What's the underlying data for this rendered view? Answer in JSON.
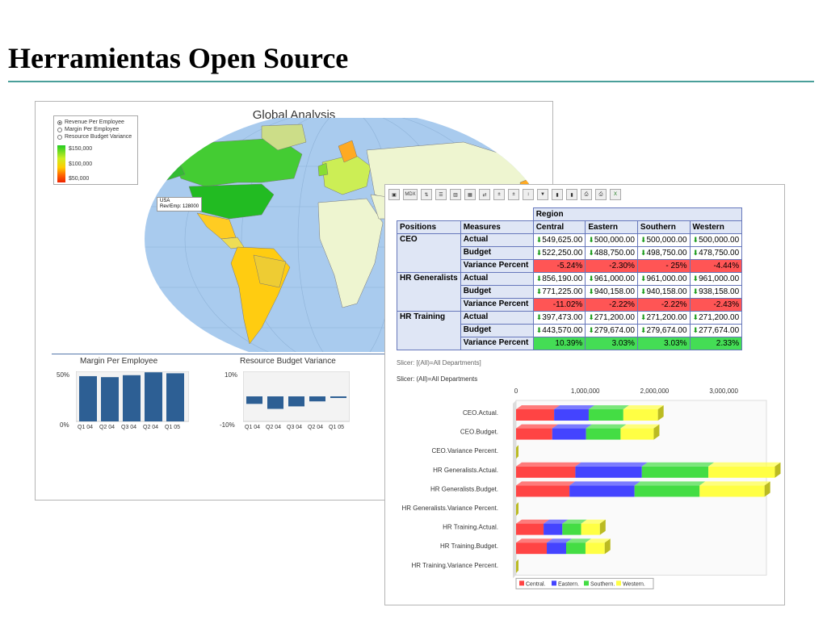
{
  "slide": {
    "title": "Herramientas Open Source"
  },
  "global_analysis": {
    "title": "Global Analysis",
    "options": [
      "Revenue Per Employee",
      "Margin Per Employee",
      "Resource Budget Variance"
    ],
    "scale_labels": [
      "$150,000",
      "$100,000",
      "$50,000"
    ],
    "tooltip": {
      "line1": "USA",
      "line2": "Rev/Emp: 128000"
    },
    "margin_chart": {
      "title": "Margin Per Employee",
      "y_ticks": [
        "50%",
        "0%"
      ],
      "categories": [
        "Q1 04",
        "Q2 04",
        "Q3 04",
        "Q2 04",
        "Q1 05"
      ],
      "values": [
        47,
        46,
        48,
        51,
        50
      ]
    },
    "budget_chart": {
      "title": "Resource Budget Variance",
      "y_ticks": [
        "10%",
        "-10%"
      ],
      "categories": [
        "Q1 04",
        "Q2 04",
        "Q3 04",
        "Q2 04",
        "Q1 05"
      ],
      "values": [
        -3,
        -5,
        -4,
        -2,
        -0.5
      ]
    }
  },
  "olap": {
    "toolbar_mdx": "MDX",
    "region_header": "Region",
    "col_positions": "Positions",
    "col_measures": "Measures",
    "regions": [
      "Central",
      "Eastern",
      "Southern",
      "Western"
    ],
    "groups": [
      {
        "position": "CEO",
        "rows": [
          {
            "measure": "Actual",
            "values": [
              "549,625.00",
              "500,000.00",
              "500,000.00",
              "500,000.00"
            ]
          },
          {
            "measure": "Budget",
            "values": [
              "522,250.00",
              "488,750.00",
              "498,750.00",
              "478,750.00"
            ]
          },
          {
            "measure": "Variance Percent",
            "values": [
              "-5.24%",
              "-2.30%",
              "- 25%",
              "-4.44%"
            ]
          }
        ]
      },
      {
        "position": "HR Generalists",
        "rows": [
          {
            "measure": "Actual",
            "values": [
              "856,190.00",
              "961,000.00",
              "961,000.00",
              "961,000.00"
            ]
          },
          {
            "measure": "Budget",
            "values": [
              "771,225.00",
              "940,158.00",
              "940,158.00",
              "938,158.00"
            ]
          },
          {
            "measure": "Variance Percent",
            "values": [
              "-11.02%",
              "-2.22%",
              "-2.22%",
              "-2.43%"
            ]
          }
        ]
      },
      {
        "position": "HR Training",
        "rows": [
          {
            "measure": "Actual",
            "values": [
              "397,473.00",
              "271,200.00",
              "271,200.00",
              "271,200.00"
            ]
          },
          {
            "measure": "Budget",
            "values": [
              "443,570.00",
              "279,674.00",
              "279,674.00",
              "277,674.00"
            ]
          },
          {
            "measure": "Variance Percent",
            "values": [
              "10.39%",
              "3.03%",
              "3.03%",
              "2.33%"
            ]
          }
        ]
      }
    ],
    "slicer_line1": "Slicer: [(All)=All Departments]",
    "slicer_line2": "Slicer: (All)=All Departments"
  },
  "chart_data": {
    "type": "bar",
    "orientation": "horizontal-stacked",
    "x_ticks": [
      "0",
      "1,000,000",
      "2,000,000",
      "3,000,000"
    ],
    "xlim": [
      0,
      3500000
    ],
    "categories": [
      "CEO.Actual.",
      "CEO.Budget.",
      "CEO.Variance Percent.",
      "HR Generalists.Actual.",
      "HR Generalists.Budget.",
      "HR Generalists.Variance Percent.",
      "HR Training.Actual.",
      "HR Training.Budget.",
      "HR Training.Variance Percent."
    ],
    "series": [
      {
        "name": "Central.",
        "color": "#ff4444",
        "values": [
          549625,
          522250,
          0,
          856190,
          771225,
          0,
          397473,
          443570,
          0
        ]
      },
      {
        "name": "Eastern.",
        "color": "#4444ff",
        "values": [
          500000,
          488750,
          0,
          961000,
          940158,
          0,
          271200,
          279674,
          0
        ]
      },
      {
        "name": "Southern.",
        "color": "#44dd44",
        "values": [
          500000,
          498750,
          0,
          961000,
          940158,
          0,
          271200,
          279674,
          0
        ]
      },
      {
        "name": "Western.",
        "color": "#ffff44",
        "values": [
          500000,
          478750,
          0,
          961000,
          938158,
          0,
          271200,
          277674,
          0
        ]
      }
    ]
  }
}
